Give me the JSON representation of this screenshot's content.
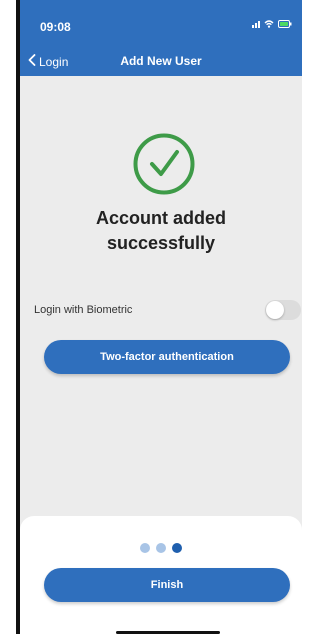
{
  "status_bar": {
    "time": "09:08"
  },
  "nav": {
    "back_label": "Login",
    "title": "Add New User"
  },
  "success": {
    "headline": "Account added\nsuccessfully"
  },
  "biometric": {
    "label": "Login with Biometric",
    "enabled": false
  },
  "actions": {
    "two_factor_label": "Two-factor authentication",
    "finish_label": "Finish"
  },
  "pager": {
    "total": 3,
    "current": 3
  },
  "colors": {
    "primary": "#2f6fbd",
    "success": "#3e9b48",
    "background": "#ececec"
  }
}
